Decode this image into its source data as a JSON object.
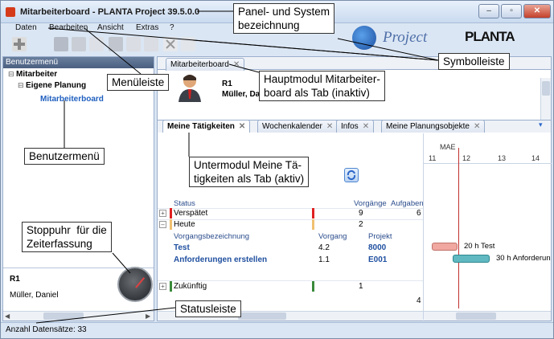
{
  "window": {
    "title": "Mitarbeiterboard - PLANTA Project 39.5.0.0",
    "minimize_label": "–",
    "maximize_label": "▫",
    "close_label": "✕"
  },
  "menu": [
    "Daten",
    "Bearbeiten",
    "Ansicht",
    "Extras",
    "?"
  ],
  "logo": {
    "project_text": "Project",
    "planta_text": "PLANTA"
  },
  "left_panel": {
    "header": "Benutzermenü",
    "tree": [
      {
        "label": "Mitarbeiter",
        "level": 0
      },
      {
        "label": "Eigene Planung",
        "level": 1
      },
      {
        "label": "Mitarbeiterboard",
        "level": 2
      }
    ],
    "user_code": "R1",
    "user_name": "Müller, Daniel"
  },
  "main_tab": {
    "label": "Mitarbeiterboard"
  },
  "employee": {
    "code": "R1",
    "name": "Müller, Dani"
  },
  "sub_tabs": [
    "Meine Tätigkeiten",
    "Wochenkalender",
    "Infos",
    "Meine Planungsobjekte"
  ],
  "tasks": {
    "header": {
      "status": "Status",
      "vorgaenge": "Vorgänge",
      "aufgaben": "Aufgaben"
    },
    "groups": [
      {
        "label": "Verspätet",
        "vorgaenge": "9",
        "aufgaben": "6",
        "color": "#e02020"
      },
      {
        "label": "Heute",
        "vorgaenge": "2",
        "aufgaben": "",
        "color": "#f0c070"
      }
    ],
    "sub_header": {
      "bezeichnung": "Vorgangsbezeichnung",
      "vorgang": "Vorgang",
      "projekt": "Projekt"
    },
    "items": [
      {
        "bezeichnung": "Test",
        "vorgang": "4.2",
        "projekt": "8000"
      },
      {
        "bezeichnung": "Anforderungen erstellen",
        "vorgang": "1.1",
        "projekt": "E001"
      }
    ],
    "future": {
      "label": "Zukünftig",
      "vorgaenge": "1",
      "color": "#3a8a3a"
    },
    "last_value": "4"
  },
  "gantt": {
    "month": "MAE",
    "days": [
      "11",
      "12",
      "13",
      "14"
    ],
    "bars": [
      {
        "label": "20 h  Test",
        "color": "#f0a8a0"
      },
      {
        "label": "30 h  Anforderun",
        "color": "#60b8c0"
      }
    ]
  },
  "status": {
    "text": "Anzahl Datensätze: 33"
  },
  "callouts": {
    "panel": "Panel- und System\nbezeichnung",
    "symbol": "Symbolleiste",
    "menu": "Menüleiste",
    "hauptmodul": "Hauptmodul Mitarbeiter-\nboard als Tab (inaktiv)",
    "benutzermenu": "Benutzermenü",
    "untermodul": "Untermodul Meine Tä-\ntigkeiten als Tab (aktiv)",
    "stoppuhr": "Stoppuhr  für die\nZeiterfassung",
    "statusleiste": "Statusleiste"
  }
}
